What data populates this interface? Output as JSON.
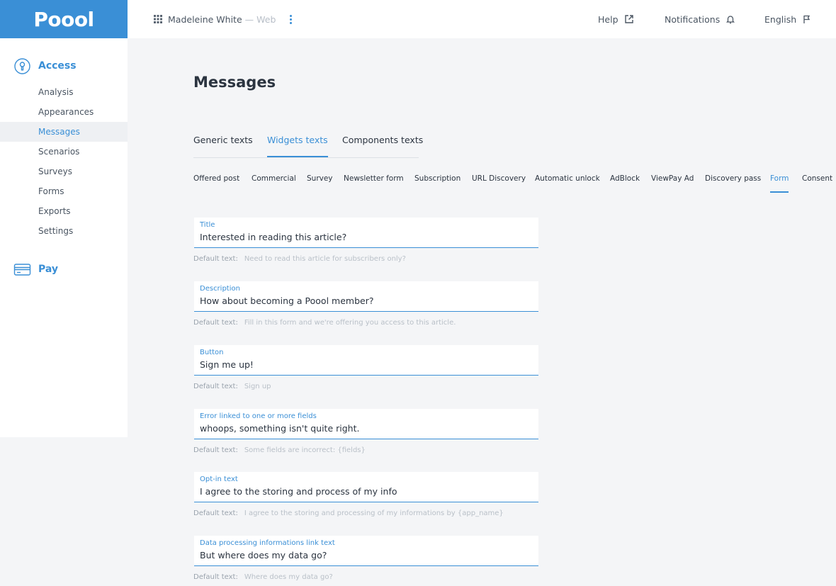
{
  "header": {
    "logo": "Poool",
    "account_name": "Madeleine White",
    "account_separator": "—",
    "account_site": "Web",
    "help_label": "Help",
    "notifications_label": "Notifications",
    "language_label": "English"
  },
  "sidebar": {
    "sections": [
      {
        "label": "Access",
        "icon": "keyhole-icon"
      },
      {
        "label": "Pay",
        "icon": "credit-card-icon"
      }
    ],
    "items": [
      {
        "label": "Analysis"
      },
      {
        "label": "Appearances"
      },
      {
        "label": "Messages",
        "active": true
      },
      {
        "label": "Scenarios"
      },
      {
        "label": "Surveys"
      },
      {
        "label": "Forms"
      },
      {
        "label": "Exports"
      },
      {
        "label": "Settings"
      }
    ]
  },
  "main": {
    "title": "Messages",
    "tabs": [
      {
        "label": "Generic texts"
      },
      {
        "label": "Widgets texts",
        "active": true
      },
      {
        "label": "Components texts"
      }
    ],
    "subtabs": [
      {
        "label": "Offered post"
      },
      {
        "label": "Commercial"
      },
      {
        "label": "Survey"
      },
      {
        "label": "Newsletter form"
      },
      {
        "label": "Subscription"
      },
      {
        "label": "URL Discovery"
      },
      {
        "label": "Automatic unlock"
      },
      {
        "label": "AdBlock"
      },
      {
        "label": "ViewPay Ad"
      },
      {
        "label": "Discovery pass"
      },
      {
        "label": "Form",
        "active": true
      },
      {
        "label": "Consent"
      }
    ],
    "default_label": "Default text:",
    "fields": [
      {
        "label": "Title",
        "value": "Interested in reading this article?",
        "default": "Need to read this article for subscribers only?"
      },
      {
        "label": "Description",
        "value": "How about becoming a Poool member?",
        "default": "Fill in this form and we're offering you access to this article."
      },
      {
        "label": "Button",
        "value": "Sign me up!",
        "default": "Sign up"
      },
      {
        "label": "Error linked to one or more fields",
        "value": "whoops, something isn't quite right.",
        "default": "Some fields are incorrect: {fields}"
      },
      {
        "label": "Opt-in text",
        "value": "I agree to the storing and process of my info",
        "default": "I agree to the storing and processing of my informations by {app_name}"
      },
      {
        "label": "Data processing informations link text",
        "value": "But where does my data go?",
        "default": "Where does my data go?"
      }
    ]
  },
  "colors": {
    "accent": "#3a8fd6",
    "background": "#f4f5f7",
    "text": "#2b3440",
    "muted": "#b9c0c8"
  }
}
